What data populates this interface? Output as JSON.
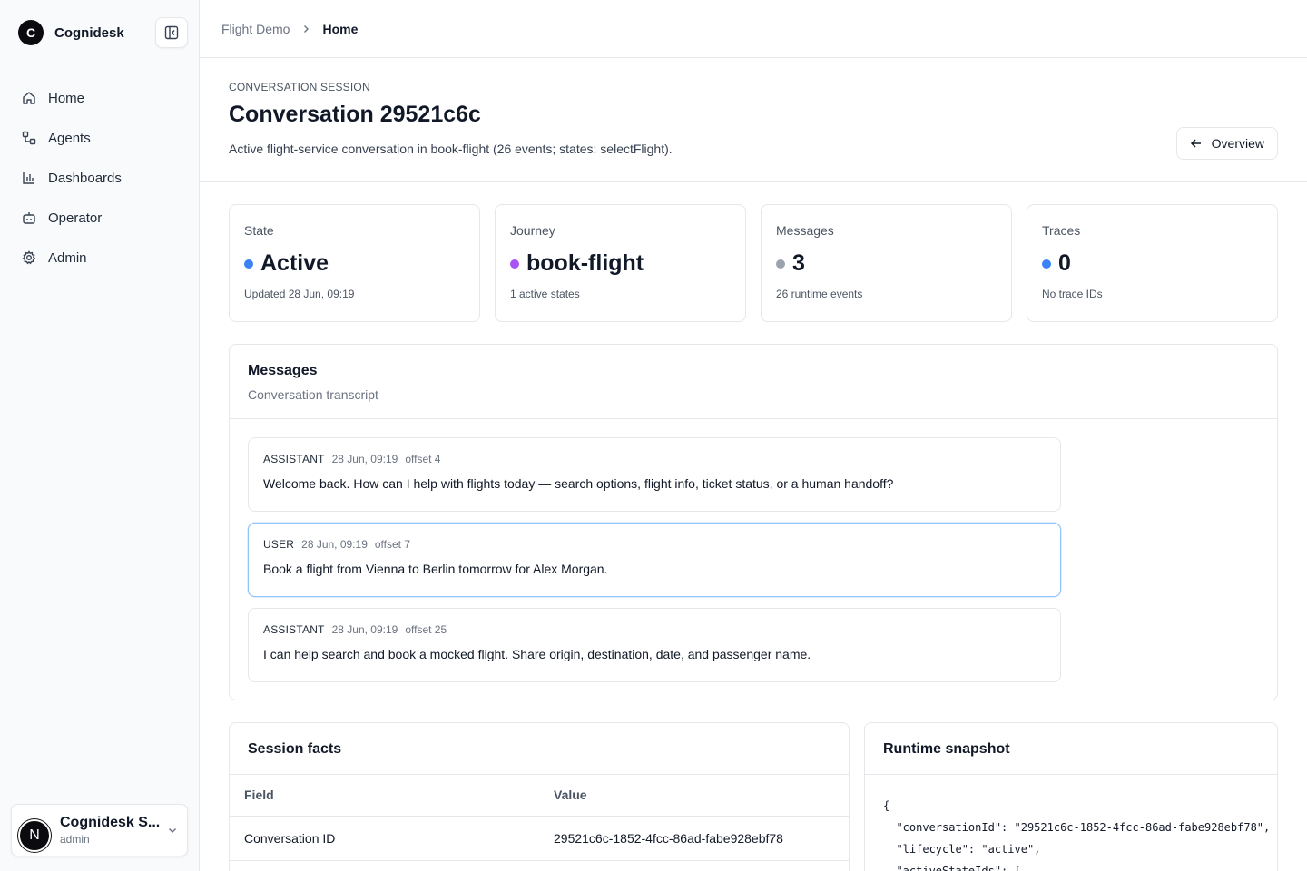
{
  "brand": {
    "logo_letter": "C",
    "name": "Cognidesk"
  },
  "nav": [
    {
      "label": "Home",
      "icon": "home-icon"
    },
    {
      "label": "Agents",
      "icon": "agents-icon"
    },
    {
      "label": "Dashboards",
      "icon": "chart-bar-icon"
    },
    {
      "label": "Operator",
      "icon": "bot-icon"
    },
    {
      "label": "Admin",
      "icon": "gear-icon"
    }
  ],
  "user": {
    "initial": "N",
    "name": "Cognidesk S...",
    "role": "admin"
  },
  "breadcrumb": {
    "parent": "Flight Demo",
    "current": "Home"
  },
  "header": {
    "eyebrow": "CONVERSATION SESSION",
    "title": "Conversation 29521c6c",
    "description": "Active flight-service conversation in book-flight (26 events; states: selectFlight).",
    "overview_label": "Overview"
  },
  "stats": [
    {
      "label": "State",
      "value": "Active",
      "sub": "Updated 28 Jun, 09:19",
      "dot_color": "#3b82f6"
    },
    {
      "label": "Journey",
      "value": "book-flight",
      "sub": "1 active states",
      "dot_color": "#a855f7"
    },
    {
      "label": "Messages",
      "value": "3",
      "sub": "26 runtime events",
      "dot_color": "#9ca3af"
    },
    {
      "label": "Traces",
      "value": "0",
      "sub": "No trace IDs",
      "dot_color": "#3b82f6"
    }
  ],
  "messages": {
    "title": "Messages",
    "subtitle": "Conversation transcript",
    "items": [
      {
        "role": "ASSISTANT",
        "time": "28 Jun, 09:19",
        "offset": "offset 4",
        "text": "Welcome back. How can I help with flights today — search options, flight info, ticket status, or a human handoff?"
      },
      {
        "role": "USER",
        "time": "28 Jun, 09:19",
        "offset": "offset 7",
        "text": "Book a flight from Vienna to Berlin tomorrow for Alex Morgan."
      },
      {
        "role": "ASSISTANT",
        "time": "28 Jun, 09:19",
        "offset": "offset 25",
        "text": "I can help search and book a mocked flight. Share origin, destination, date, and passenger name."
      }
    ]
  },
  "facts": {
    "title": "Session facts",
    "columns": [
      "Field",
      "Value"
    ],
    "rows": [
      {
        "field": "Conversation ID",
        "value": "29521c6c-1852-4fcc-86ad-fabe928ebf78"
      }
    ]
  },
  "snapshot": {
    "title": "Runtime snapshot",
    "json_text": "{\n  \"conversationId\": \"29521c6c-1852-4fcc-86ad-fabe928ebf78\",\n  \"lifecycle\": \"active\",\n  \"activeStateIds\": ["
  }
}
